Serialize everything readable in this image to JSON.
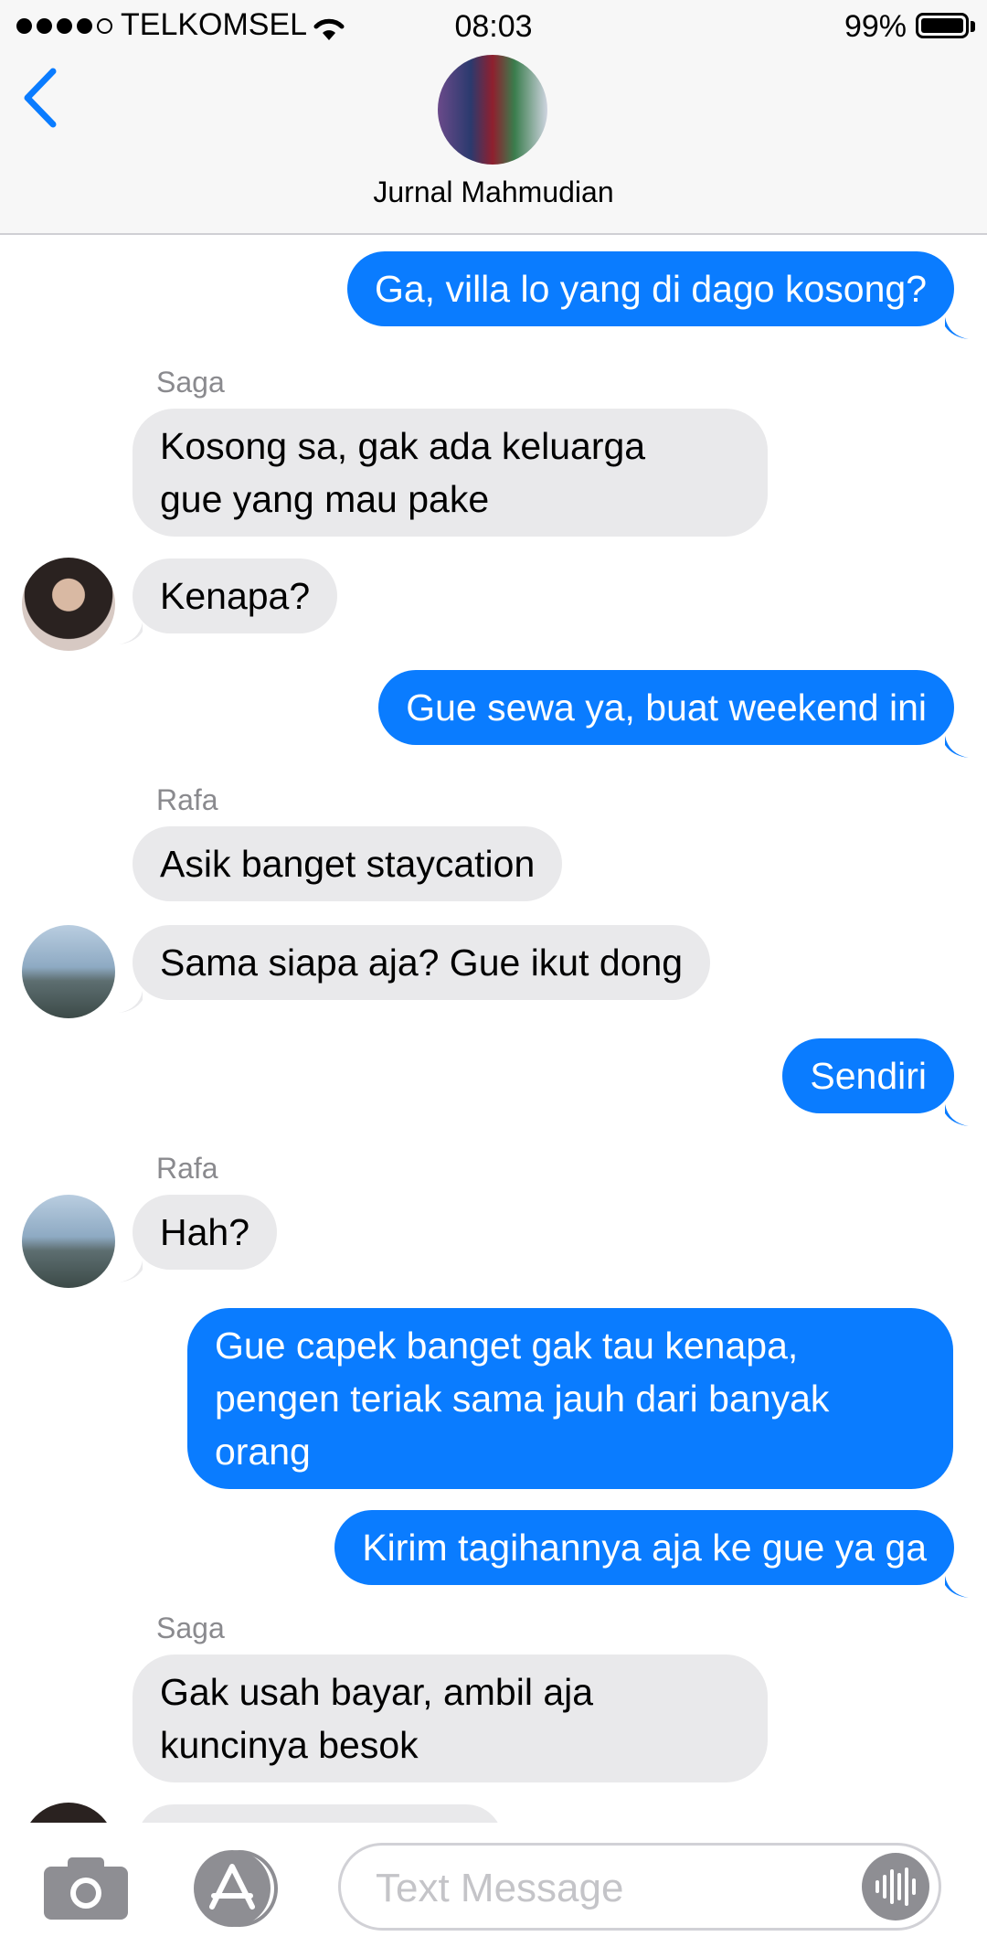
{
  "status_bar": {
    "carrier": "TELKOMSEL",
    "time": "08:03",
    "battery": "99%"
  },
  "header": {
    "group_name": "Jurnal Mahmudian",
    "icon": "chevron-left-icon"
  },
  "messages": [
    {
      "from": "me",
      "text": "Ga, villa lo yang di dago kosong?"
    },
    {
      "from": "Saga",
      "sender_label": "Saga",
      "text_lines": [
        "Kosong sa, gak ada keluarga",
        "gue yang mau pake"
      ]
    },
    {
      "from": "Saga",
      "text": "Kenapa?"
    },
    {
      "from": "me",
      "text": "Gue sewa ya, buat weekend ini"
    },
    {
      "from": "Rafa",
      "sender_label": "Rafa",
      "text": "Asik banget staycation"
    },
    {
      "from": "Rafa",
      "text": "Sama siapa aja? Gue ikut dong"
    },
    {
      "from": "me",
      "text": "Sendiri"
    },
    {
      "from": "Rafa",
      "sender_label": "Rafa",
      "text": "Hah?"
    },
    {
      "from": "me",
      "text_lines": [
        "Gue capek banget gak tau kenapa,",
        "pengen teriak sama jauh dari banyak",
        "orang"
      ]
    },
    {
      "from": "me",
      "text": "Kirim tagihannya aja ke gue ya ga"
    },
    {
      "from": "Saga",
      "sender_label": "Saga",
      "text_lines": [
        "Gak usah bayar, ambil aja",
        "kuncinya besok"
      ]
    }
  ],
  "input": {
    "placeholder": "Text Message",
    "icons": [
      "camera-icon",
      "app-store-icon",
      "audio-message-icon"
    ]
  },
  "colors": {
    "accent": "#0a7cff",
    "incoming_bubble": "#e9e9eb"
  }
}
